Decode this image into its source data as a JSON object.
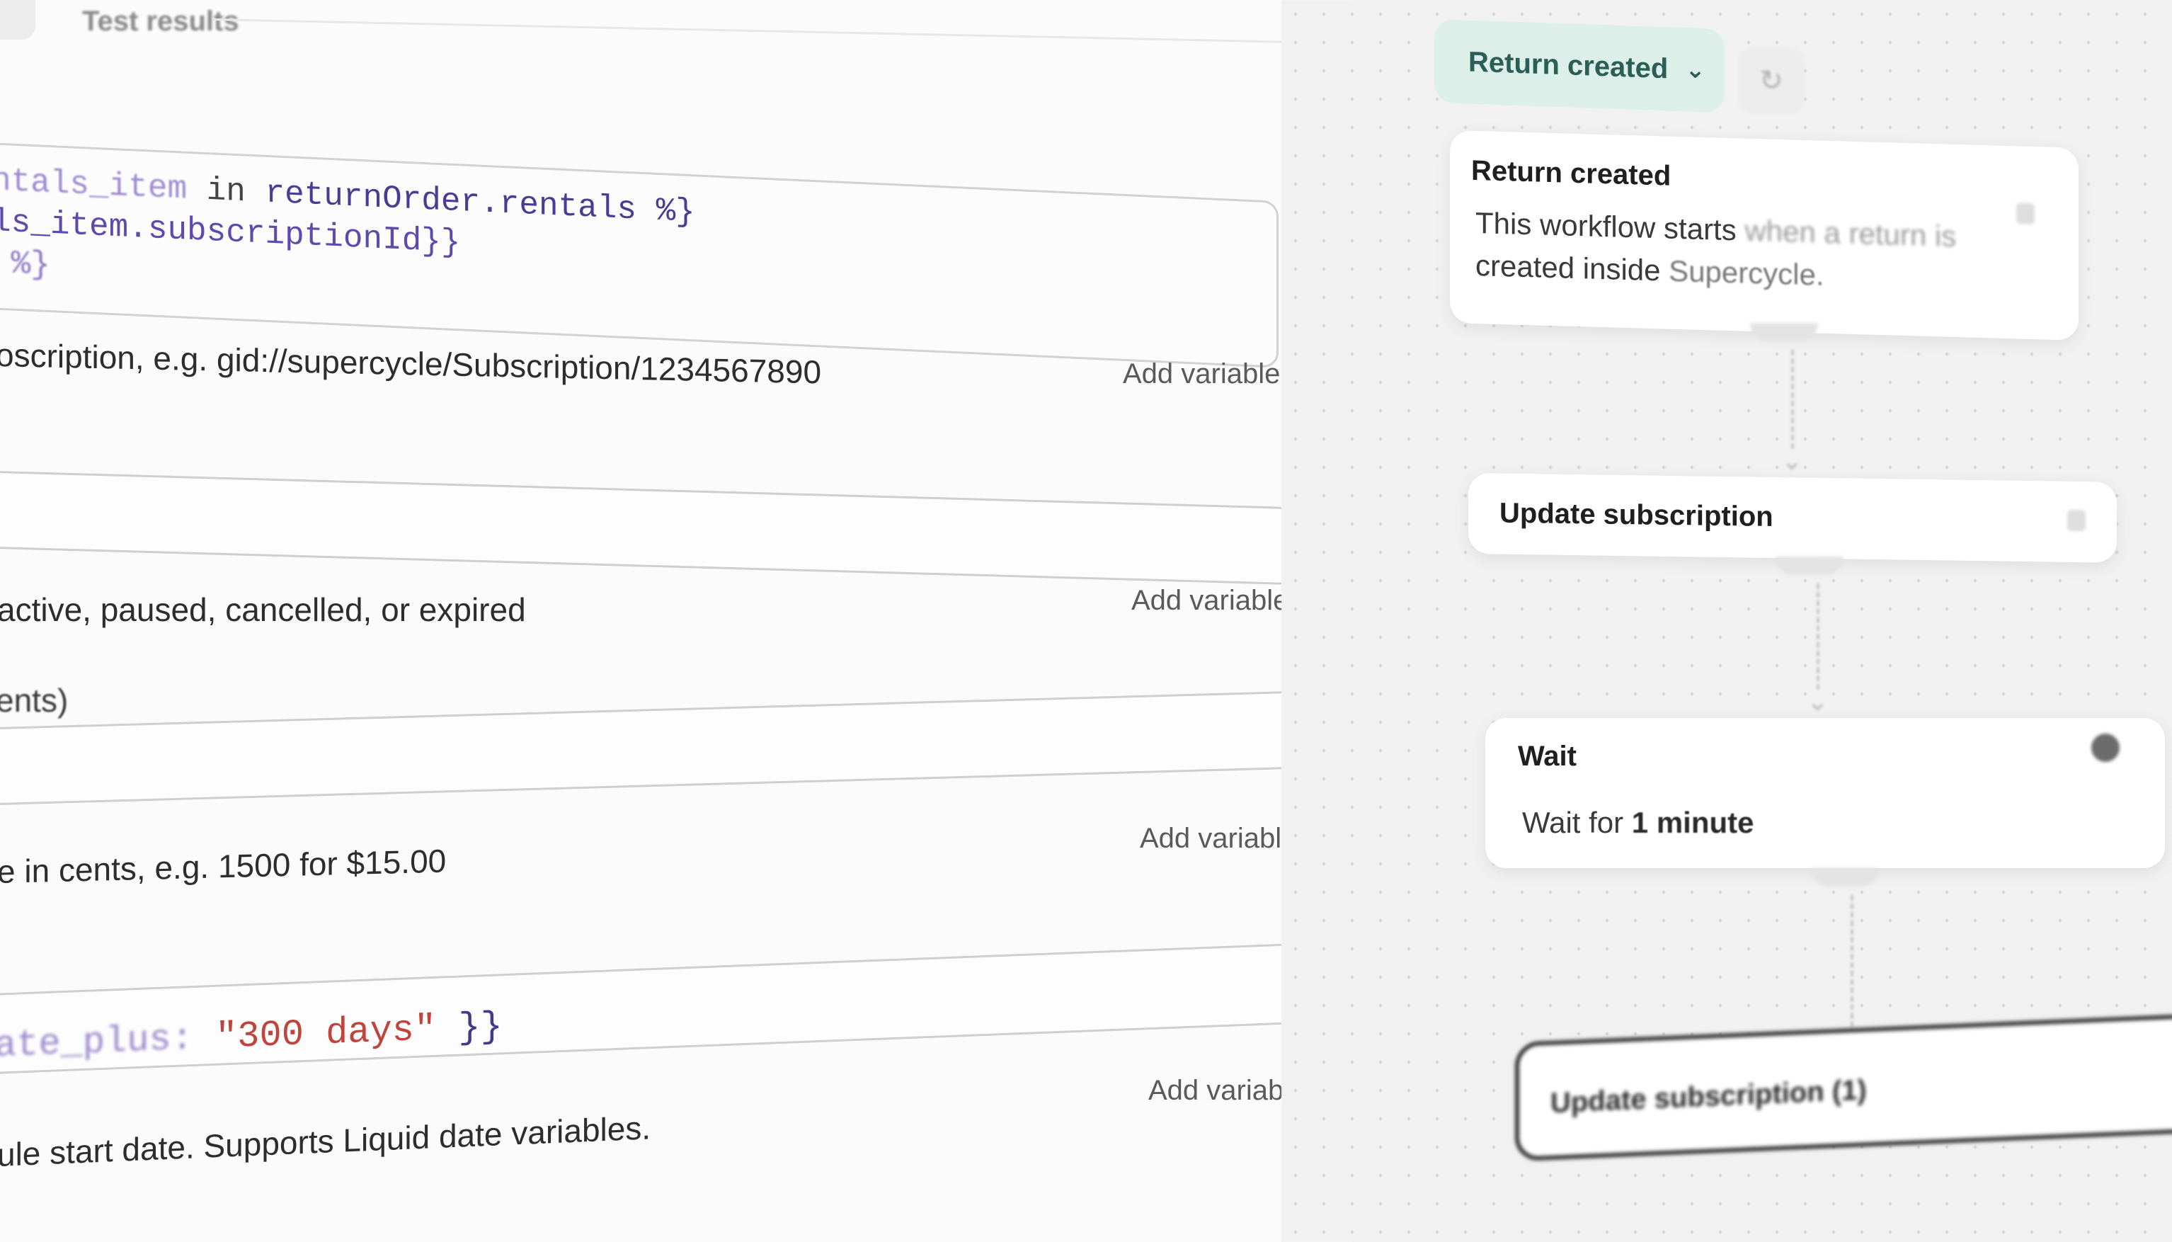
{
  "left_panel": {
    "tab_label": "Test results",
    "code_block": {
      "line1": {
        "prefix": "ntals_item",
        "keyword": " in ",
        "variable": "returnOrder",
        "rest": ".rentals %}"
      },
      "line2": "ls_item.subscriptionId}}",
      "line3": " %}"
    },
    "fields": [
      {
        "help": "oscription, e.g. gid://supercycle/Subscription/1234567890",
        "add_variable": "Add variable"
      },
      {
        "help": "active, paused, cancelled, or expired",
        "add_variable": "Add variable"
      },
      {
        "label": "ents)",
        "help": "e in cents, e.g. 1500 for $15.00",
        "add_variable": "Add variable"
      },
      {
        "code": {
          "prop": "ate_plus:",
          "string": "\"300 days\"",
          "brace": "}}"
        },
        "help": "ule start date. Supports Liquid date variables.",
        "add_variable": "Add variable"
      }
    ]
  },
  "canvas": {
    "trigger_selector": {
      "label": "Return created"
    },
    "nodes": [
      {
        "title": "Return created",
        "description_line1": "This workflow starts",
        "description_line1_faded": " when a return is",
        "description_line2": "created inside",
        "description_line2_faded": " Supercycle."
      },
      {
        "title": "Update subscription"
      },
      {
        "title": "Wait",
        "description_prefix": "Wait for ",
        "description_bold": "1 minute"
      },
      {
        "title": "Update subscription (1)"
      }
    ]
  },
  "icons": {
    "chevron": "chevron-down-icon",
    "refresh": "refresh-icon",
    "node_menu": "node-menu-icon",
    "status": "status-dot-icon",
    "arrow": "arrow-down-icon"
  },
  "colors": {
    "trigger_bg": "#dcefe8",
    "trigger_text": "#2b5e57",
    "code_variable": "#4c3b94",
    "code_string": "#c0443b"
  }
}
